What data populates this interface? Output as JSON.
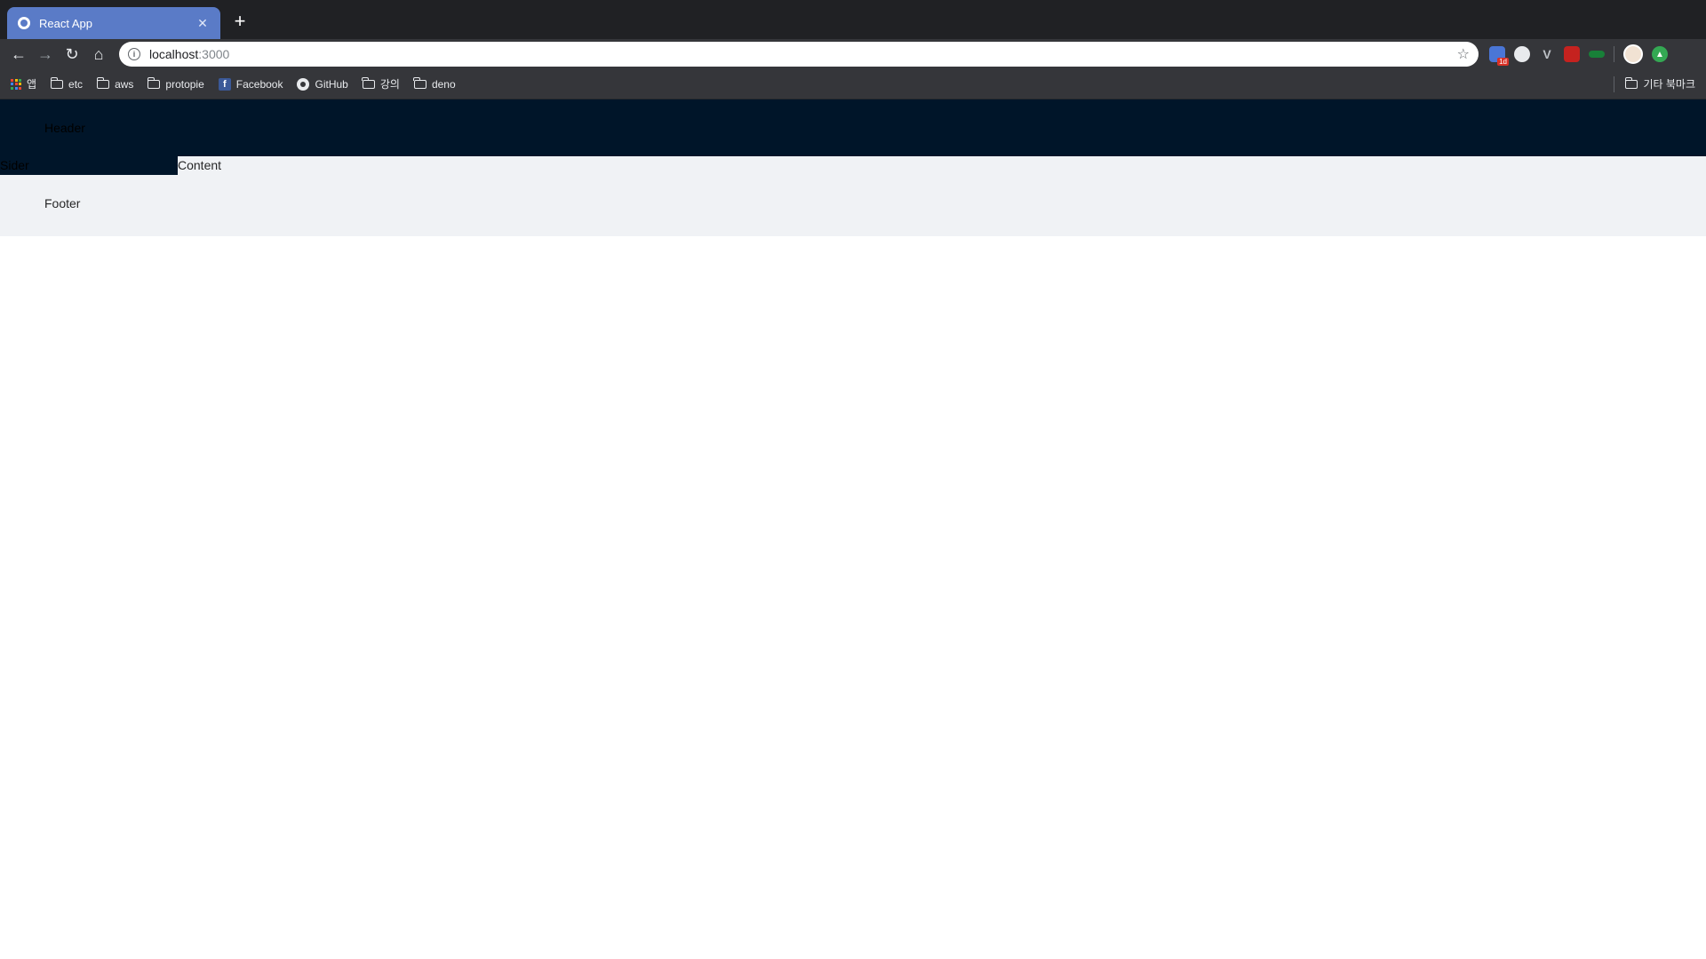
{
  "browser": {
    "tab": {
      "title": "React App",
      "close": "✕"
    },
    "new_tab": "+",
    "address": {
      "host": "localhost",
      "port": ":3000"
    },
    "nav": {
      "back": "←",
      "forward": "→",
      "reload": "↻",
      "home": "⌂"
    },
    "star": "☆",
    "bookmarks": [
      {
        "label": "앱",
        "icon": "apps-icon"
      },
      {
        "label": "etc",
        "icon": "folder-icon"
      },
      {
        "label": "aws",
        "icon": "folder-icon"
      },
      {
        "label": "protopie",
        "icon": "folder-icon"
      },
      {
        "label": "Facebook",
        "icon": "facebook-icon"
      },
      {
        "label": "GitHub",
        "icon": "github-icon"
      },
      {
        "label": "강의",
        "icon": "folder-icon"
      },
      {
        "label": "deno",
        "icon": "folder-icon"
      }
    ],
    "other_bookmarks": "기타 북마크",
    "extension_badge": "1d"
  },
  "app": {
    "header": "Header",
    "sider": "Sider",
    "content": "Content",
    "footer": "Footer"
  },
  "colors": {
    "header_bg": "#001529",
    "layout_bg": "#f0f2f5",
    "tab_active": "#5a7bc7"
  }
}
